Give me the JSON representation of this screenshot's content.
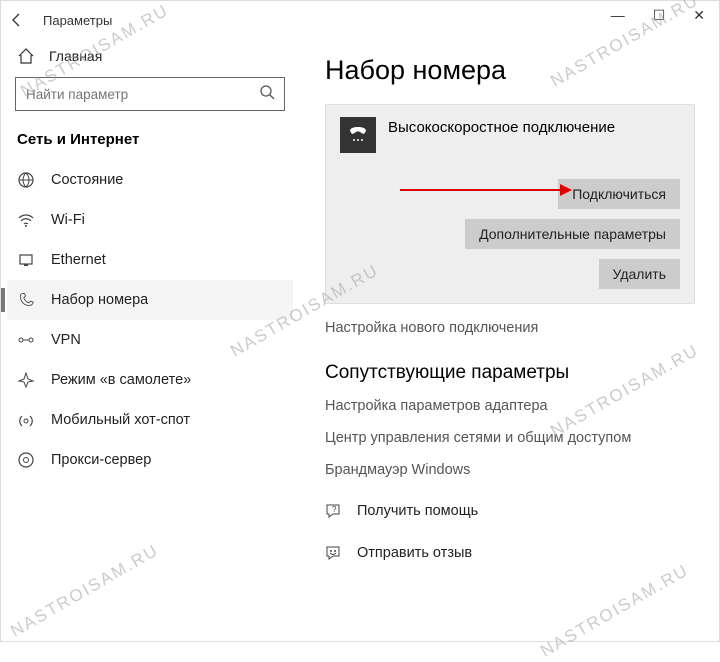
{
  "window": {
    "title": "Параметры"
  },
  "sidebar": {
    "home": "Главная",
    "search_placeholder": "Найти параметр",
    "category": "Сеть и Интернет",
    "items": [
      {
        "label": "Состояние"
      },
      {
        "label": "Wi-Fi"
      },
      {
        "label": "Ethernet"
      },
      {
        "label": "Набор номера"
      },
      {
        "label": "VPN"
      },
      {
        "label": "Режим «в самолете»"
      },
      {
        "label": "Мобильный хот-спот"
      },
      {
        "label": "Прокси-сервер"
      }
    ]
  },
  "main": {
    "title": "Набор номера",
    "connection_name": "Высокоскоростное подключение",
    "btn_connect": "Подключиться",
    "btn_advanced": "Дополнительные параметры",
    "btn_delete": "Удалить",
    "new_connection": "Настройка нового подключения",
    "related_title": "Сопутствующие параметры",
    "related_links": [
      "Настройка параметров адаптера",
      "Центр управления сетями и общим доступом",
      "Брандмауэр Windows"
    ],
    "help": "Получить помощь",
    "feedback": "Отправить отзыв"
  },
  "watermark": "NASTROISAM.RU"
}
